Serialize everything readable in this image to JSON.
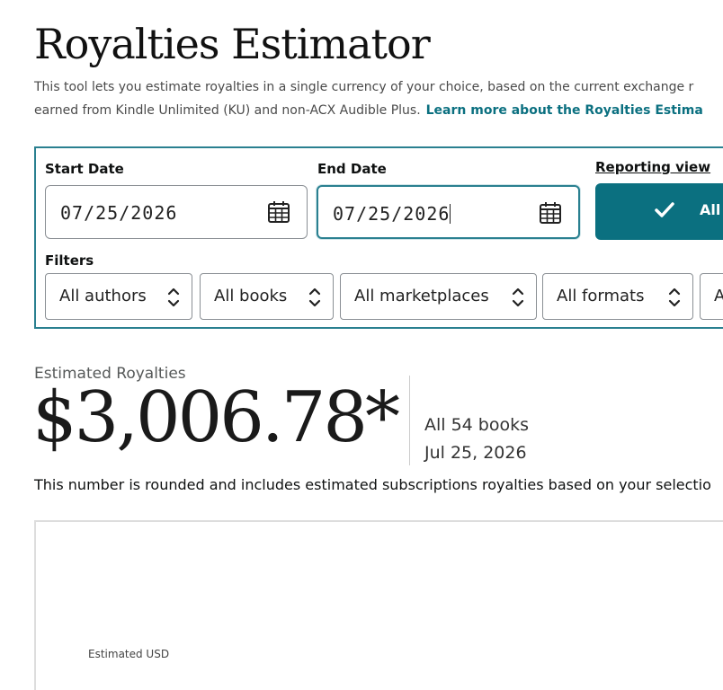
{
  "header": {
    "title": "Royalties Estimator",
    "description_line1": "This tool lets you estimate royalties in a single currency of your choice, based on the current exchange r",
    "description_line2": "earned from Kindle Unlimited (KU) and non-ACX Audible Plus.",
    "learn_more_link": "Learn more about the Royalties Estima"
  },
  "filters_panel": {
    "start_date_label": "Start Date",
    "start_date_value": "07/25/2026",
    "end_date_label": "End Date",
    "end_date_value": "07/25/2026",
    "reporting_view_label": "Reporting view",
    "reporting_view_button": "All",
    "filters_label": "Filters",
    "filters": [
      {
        "label": "All authors"
      },
      {
        "label": "All books"
      },
      {
        "label": "All marketplaces"
      },
      {
        "label": "All formats"
      },
      {
        "label": "A"
      }
    ]
  },
  "summary": {
    "label": "Estimated Royalties",
    "amount": "$3,006.78*",
    "scope": "All 54 books",
    "date": "Jul 25, 2026",
    "note": "This number is rounded and includes estimated subscriptions royalties based on your selectio"
  },
  "chart": {
    "axis_label": "Estimated USD"
  },
  "colors": {
    "accent": "#0b7080",
    "panel_border": "#2a8090",
    "text": "#0f1111"
  }
}
